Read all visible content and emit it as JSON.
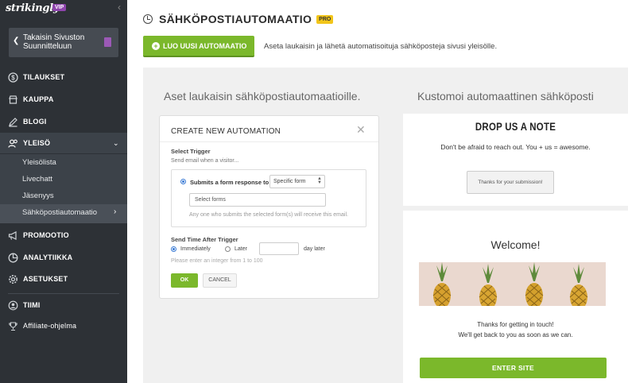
{
  "sidebar": {
    "logo": "strikingly",
    "vip_badge": "VIP",
    "collapse_icon": "‹",
    "back_label": "Takaisin Sivuston Suunnitteluun",
    "nav": {
      "tilaukset": "TILAUKSET",
      "kauppa": "KAUPPA",
      "blogi": "BLOGI",
      "yleiso": "YLEISÖ",
      "promootio": "PROMOOTIO",
      "analytiikka": "ANALYTIIKKA",
      "asetukset": "ASETUKSET",
      "tiimi": "TIIMI",
      "affiliate": "Affiliate-ohjelma"
    },
    "sub": {
      "yleisolista": "Yleisölista",
      "livechatt": "Livechatt",
      "jasenyys": "Jäsenyys",
      "sahkoposti": "Sähköpostiautomaatio"
    }
  },
  "header": {
    "title": "SÄHKÖPOSTIAUTOMAATIO",
    "badge": "PRO",
    "new_button": "LUO UUSI AUTOMAATIO",
    "intro": "Aseta laukaisin ja lähetä automatisoituja sähköposteja sivusi yleisölle."
  },
  "left_heading": "Aset laukaisin sähköpostiautomaatioille.",
  "right_heading": "Kustomoi automaattinen sähköposti",
  "modal": {
    "title": "CREATE NEW AUTOMATION",
    "close": "✕",
    "select_trigger": "Select Trigger",
    "send_when": "Send email when a visitor...",
    "trigger_option": "Submits a form response to",
    "form_type": "Specific form",
    "select_forms_placeholder": "Select forms",
    "hint": "Any one who submits the selected form(s) will receive this email.",
    "send_time": "Send Time After Trigger",
    "immediately": "Immediately",
    "later": "Later",
    "day_later": "day later",
    "integer_hint": "Please enter an integer from 1 to 100",
    "ok": "OK",
    "cancel": "CANCEL"
  },
  "preview1": {
    "title": "DROP US A NOTE",
    "subtitle": "Don't be afraid to reach out. You + us = awesome.",
    "button": "Thanks for your submission!"
  },
  "preview2": {
    "title": "Welcome!",
    "line1": "Thanks for getting in touch!",
    "line2": "We'll get back to you as soon as we can.",
    "button": "ENTER SITE"
  },
  "colors": {
    "accent_green": "#7bb82b",
    "sidebar_bg": "#2d3136",
    "pro_yellow": "#f2c51a",
    "vip_purple": "#8e44ad"
  }
}
